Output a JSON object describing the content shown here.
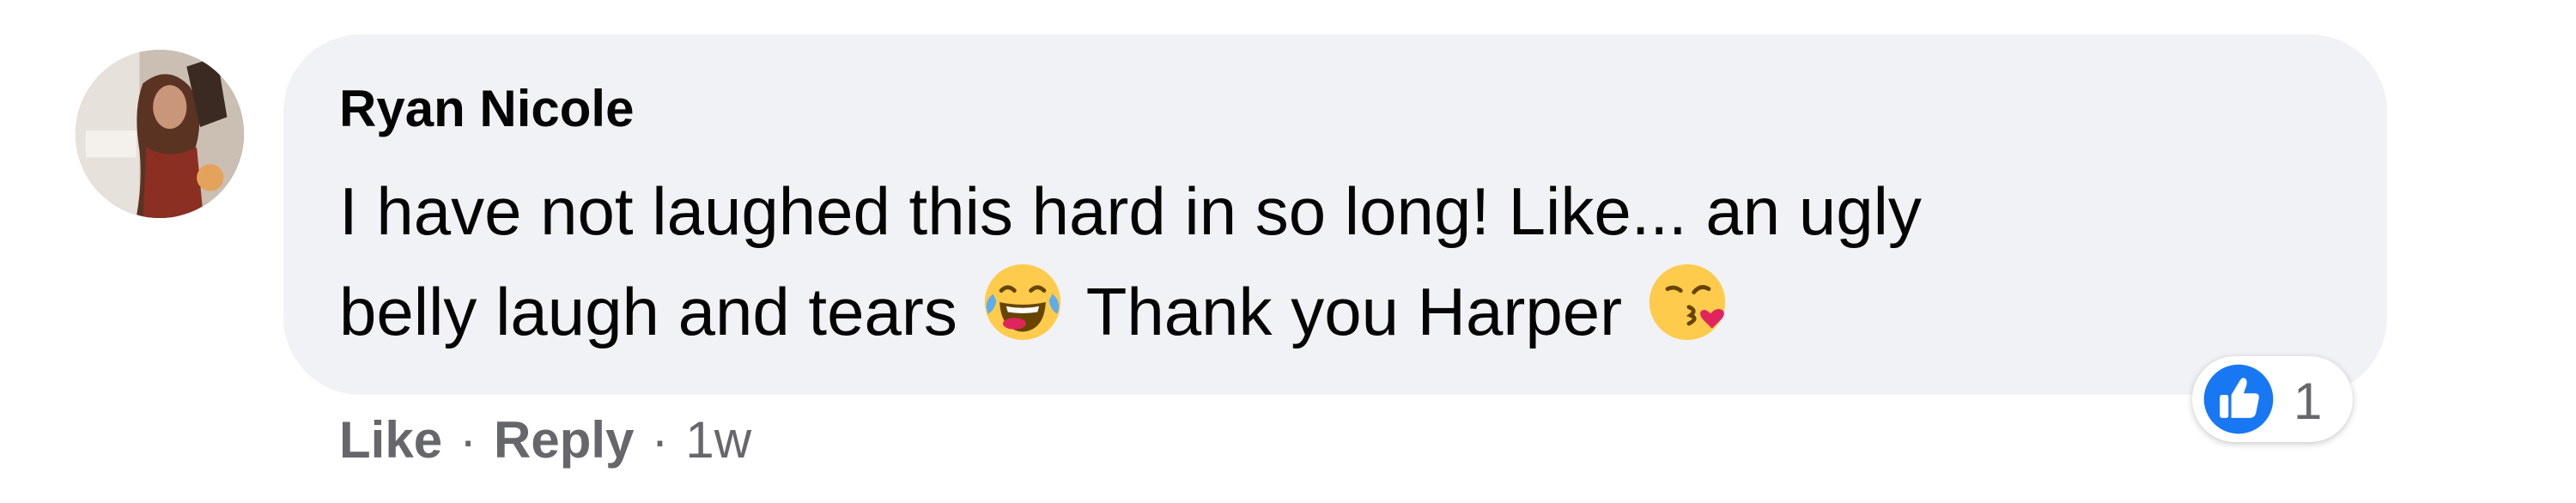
{
  "comment": {
    "author": "Ryan Nicole",
    "text_line1": "I have not laughed this hard in so long! Like... an ugly",
    "text_line2_a": "belly laugh and tears",
    "text_line2_b": "Thank you Harper",
    "emoji_1": "face-with-tears-of-joy-icon",
    "emoji_2": "face-blowing-a-kiss-icon"
  },
  "actions": {
    "like": "Like",
    "reply": "Reply",
    "separator": "·",
    "time": "1w"
  },
  "reactions": {
    "icon": "thumbs-up-icon",
    "count": "1"
  },
  "colors": {
    "bubble": "#f0f2f5",
    "text": "#050505",
    "secondary": "#65676b",
    "like_blue": "#1877f2"
  }
}
